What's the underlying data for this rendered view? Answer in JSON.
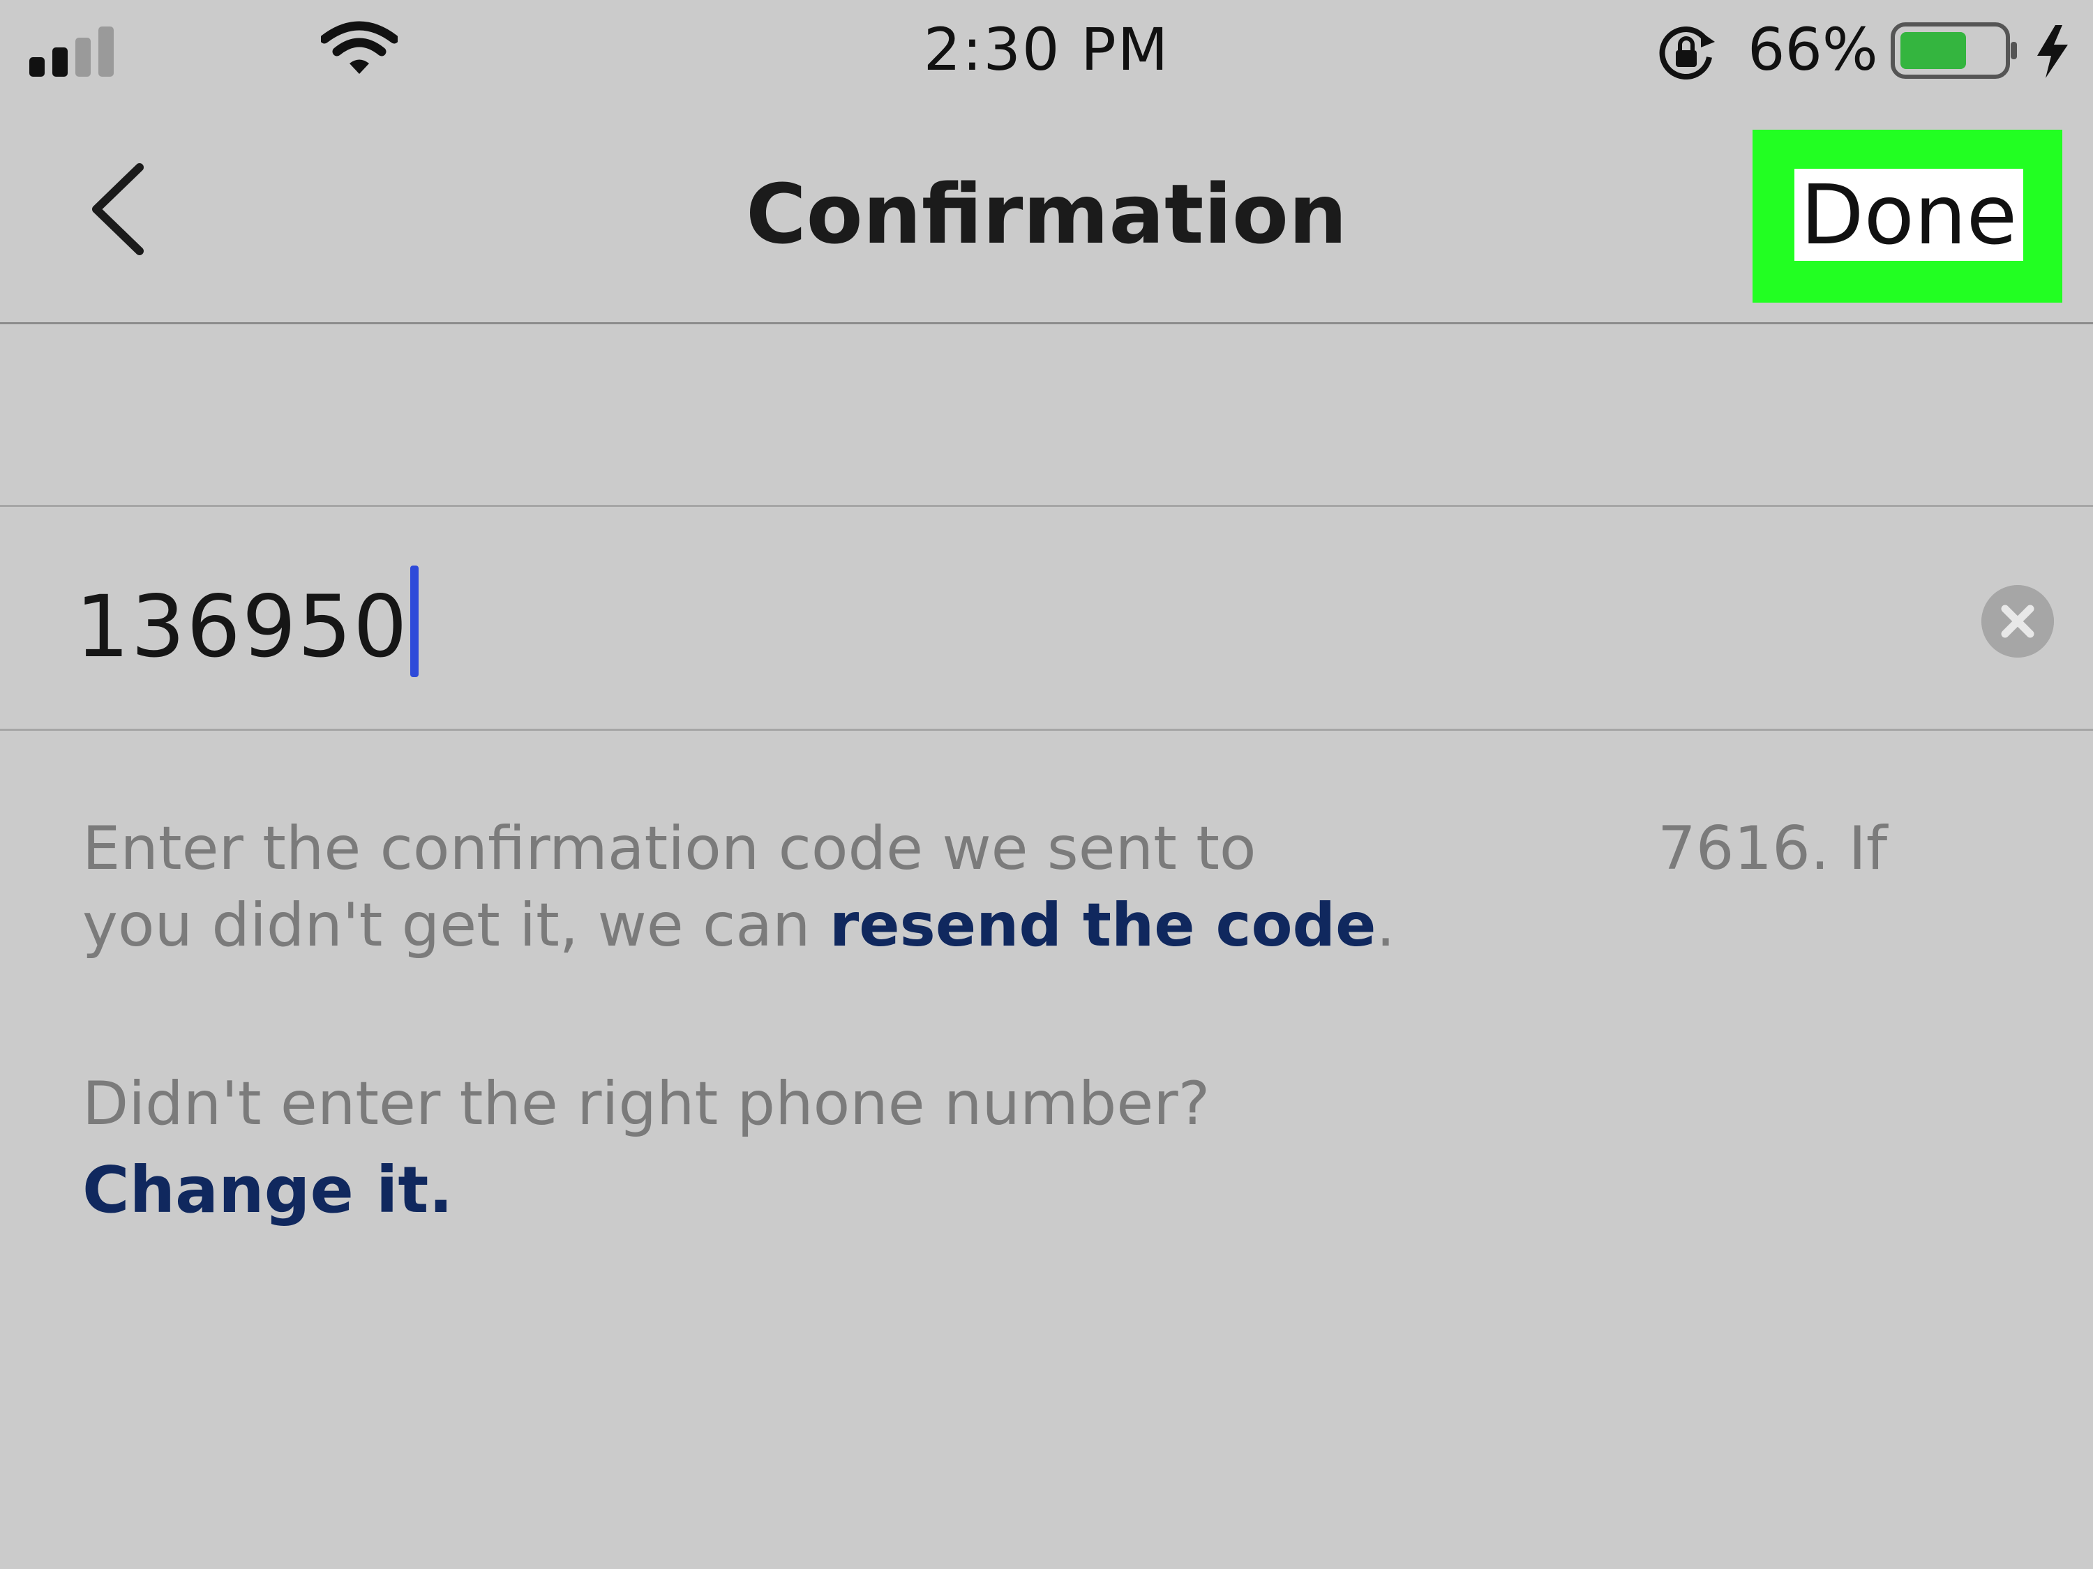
{
  "status_bar": {
    "time": "2:30 PM",
    "battery_percent": "66%",
    "battery_level": 0.66,
    "signal_bars_filled": 2,
    "signal_bars_total": 4,
    "icons": [
      "signal-icon",
      "wifi-icon",
      "rotation-lock-icon",
      "battery-icon",
      "charging-bolt-icon"
    ]
  },
  "nav": {
    "title": "Confirmation",
    "back_icon": "chevron-left-icon",
    "done_label": "Done",
    "highlight_color": "#22ff22"
  },
  "code_field": {
    "value": "136950",
    "clear_icon": "clear-circle-icon",
    "caret_color": "#2e4ad9"
  },
  "instructions": {
    "prefix": "Enter the confirmation code we sent to",
    "phone_tail": "7616. If",
    "line2_prefix": "you didn't get it, we can ",
    "resend_link": "resend the code",
    "line2_suffix": "."
  },
  "change_number": {
    "question": "Didn't enter the right phone number?",
    "link": "Change it."
  },
  "colors": {
    "background": "#cbcbcb",
    "link": "#10285e",
    "muted_text": "#7b7b7b"
  }
}
